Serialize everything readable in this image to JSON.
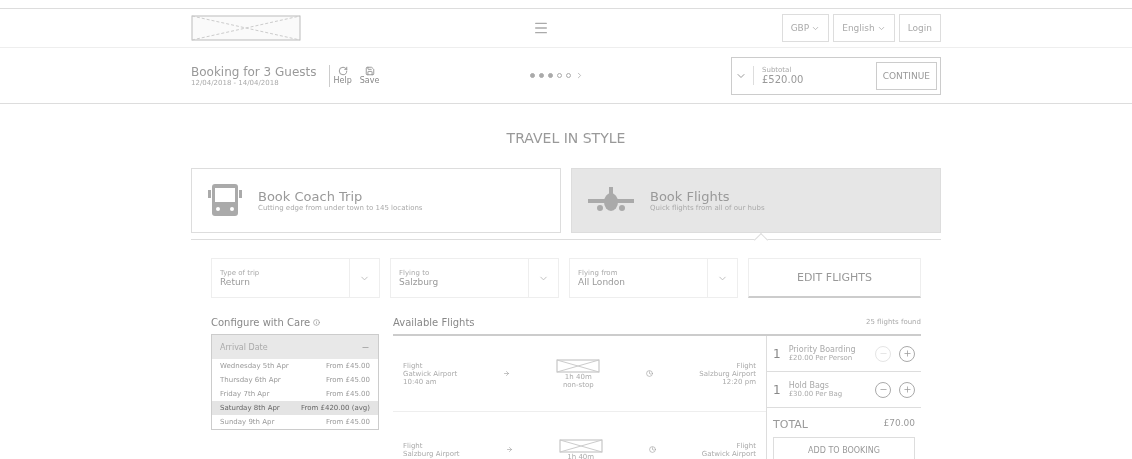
{
  "header": {
    "menu": true,
    "currency": "GBP",
    "language": "English",
    "login": "Login"
  },
  "booking_bar": {
    "title": "Booking for 3 Guests",
    "dates": "12/04/2018 - 14/04/2018",
    "actions": [
      {
        "label": "Help",
        "kind": "refresh"
      },
      {
        "label": "Save",
        "kind": "save"
      }
    ],
    "steps": [
      {
        "done": true
      },
      {
        "done": true
      },
      {
        "done": true
      },
      {
        "done": false
      },
      {
        "done": false
      }
    ],
    "subtotal_label": "Subtotal",
    "subtotal": "£520.00",
    "continue": "CONTINUE"
  },
  "heading": "TRAVEL IN STYLE",
  "tabs": [
    {
      "kind": "coach",
      "title": "Book Coach Trip",
      "subtitle": "Cutting edge from under town to 145 locations",
      "selected": false
    },
    {
      "kind": "flight",
      "title": "Book Flights",
      "subtitle": "Quick flights from all of our hubs",
      "selected": true
    }
  ],
  "selects": [
    {
      "label": "Type of trip",
      "value": "Return"
    },
    {
      "label": "Flying to",
      "value": "Salzburg"
    },
    {
      "label": "Flying from",
      "value": "All London"
    }
  ],
  "edit_button": "EDIT FLIGHTS",
  "configure": {
    "title": "Configure with Care",
    "accordion": {
      "title": "Arrival Date",
      "expanded": true,
      "items": [
        {
          "day": "Wednesday 5th Apr",
          "price": "From £45.00",
          "selected": false
        },
        {
          "day": "Thursday 6th Apr",
          "price": "From £45.00",
          "selected": false
        },
        {
          "day": "Friday 7th Apr",
          "price": "From £45.00",
          "selected": false
        },
        {
          "day": "Saturday 8th Apr",
          "price": "From £420.00 (avg)",
          "selected": true
        },
        {
          "day": "Sunday 9th Apr",
          "price": "From £45.00",
          "selected": false
        }
      ]
    }
  },
  "flights": {
    "title": "Available Flights",
    "count": "25 flights found",
    "rows": [
      {
        "from_label": "Flight",
        "from": "Gatwick Airport",
        "from_time": "10:40 am",
        "duration": "1h 40m",
        "stops": "non-stop",
        "to_label": "Flight",
        "to": "Salzburg Airport",
        "to_time": "12:20 pm"
      },
      {
        "from_label": "Flight",
        "from": "Salzburg Airport",
        "duration": "1h 40m",
        "to_label": "Flight",
        "to": "Gatwick Airport"
      }
    ]
  },
  "extras": [
    {
      "qty": "1",
      "name": "Priority Boarding",
      "price": "£20.00 Per Person",
      "can_decrease": false
    },
    {
      "qty": "1",
      "name": "Hold Bags",
      "price": "£30.00 Per Bag",
      "can_decrease": true
    }
  ],
  "total_label": "TOTAL",
  "total": "£70.00",
  "add_button": "ADD TO BOOKING"
}
